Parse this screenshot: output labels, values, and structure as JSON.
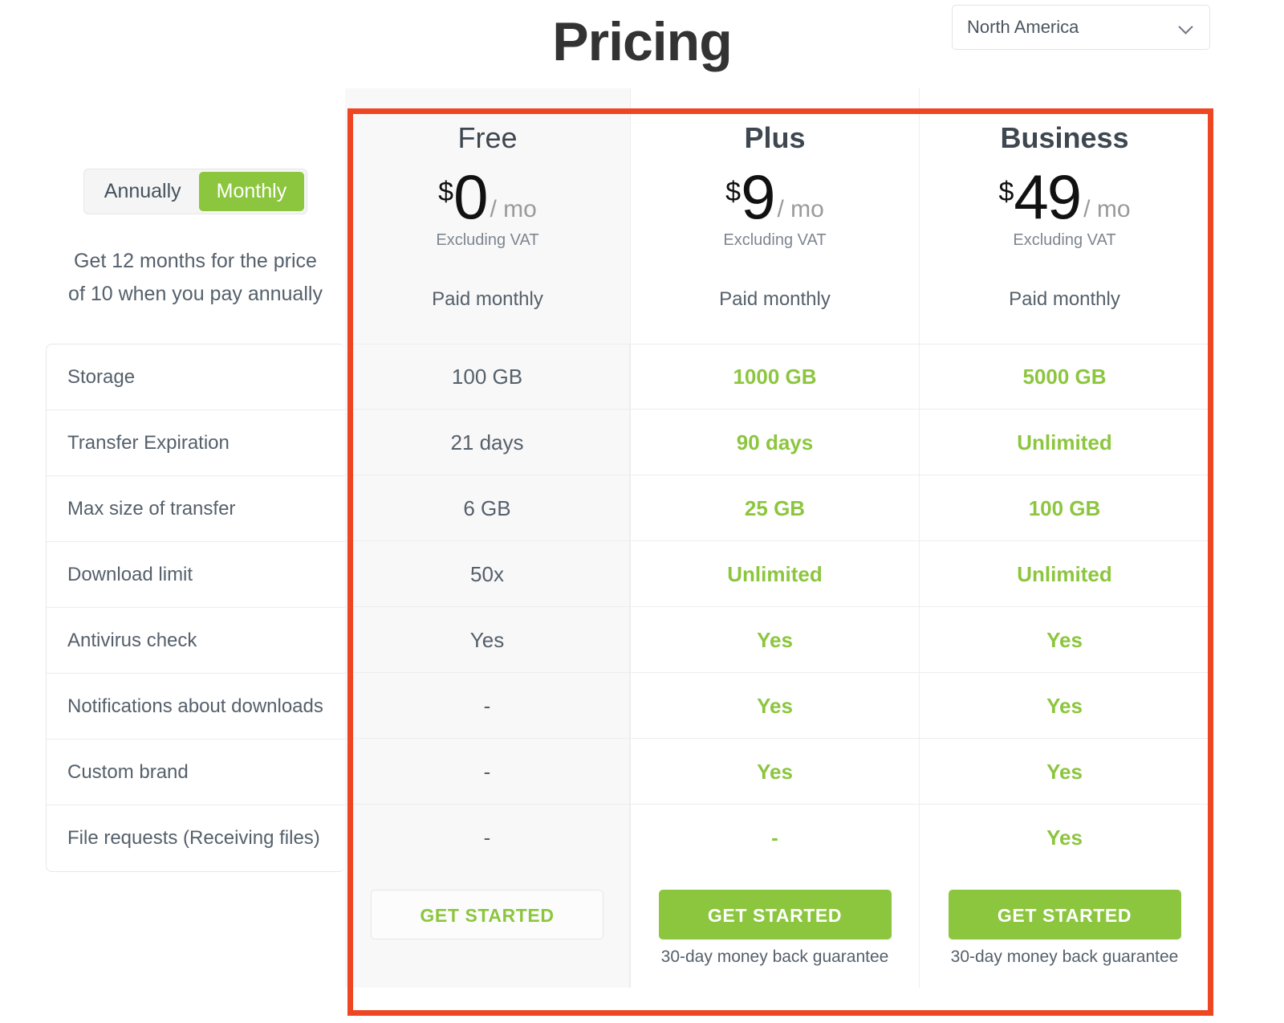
{
  "header": {
    "title": "Pricing",
    "region_selector": {
      "value": "North America",
      "icon": "chevron-down-icon"
    }
  },
  "billing": {
    "options": [
      {
        "label": "Annually",
        "active": false
      },
      {
        "label": "Monthly",
        "active": true
      }
    ],
    "note": "Get 12 months for the price of 10 when you pay annually"
  },
  "plans": [
    {
      "name": "Free",
      "currency": "$",
      "amount": "0",
      "period": "/ mo",
      "vat_note": "Excluding VAT",
      "billing_note": "Paid monthly",
      "cta": "GET STARTED",
      "cta_style": "ghost",
      "guarantee": "",
      "highlighted": false
    },
    {
      "name": "Plus",
      "currency": "$",
      "amount": "9",
      "period": "/ mo",
      "vat_note": "Excluding VAT",
      "billing_note": "Paid monthly",
      "cta": "GET STARTED",
      "cta_style": "solid",
      "guarantee": "30-day money back guarantee",
      "highlighted": false
    },
    {
      "name": "Business",
      "currency": "$",
      "amount": "49",
      "period": "/ mo",
      "vat_note": "Excluding VAT",
      "billing_note": "Paid monthly",
      "cta": "GET STARTED",
      "cta_style": "solid",
      "guarantee": "30-day money back guarantee",
      "highlighted": false
    }
  ],
  "features": [
    {
      "label": "Storage",
      "free": "100 GB",
      "plus": "1000 GB",
      "business": "5000 GB"
    },
    {
      "label": "Transfer Expiration",
      "free": "21 days",
      "plus": "90 days",
      "business": "Unlimited"
    },
    {
      "label": "Max size of transfer",
      "free": "6 GB",
      "plus": "25 GB",
      "business": "100 GB"
    },
    {
      "label": "Download limit",
      "free": "50x",
      "plus": "Unlimited",
      "business": "Unlimited"
    },
    {
      "label": "Antivirus check",
      "free": "Yes",
      "plus": "Yes",
      "business": "Yes"
    },
    {
      "label": "Notifications about downloads",
      "free": "-",
      "plus": "Yes",
      "business": "Yes"
    },
    {
      "label": "Custom brand",
      "free": "-",
      "plus": "Yes",
      "business": "Yes"
    },
    {
      "label": "File requests (Receiving files)",
      "free": "-",
      "plus": "-",
      "business": "Yes"
    }
  ],
  "colors": {
    "accent_green": "#8CC63E",
    "highlight_red": "#EE4622",
    "text": "#55606b",
    "shaded_bg": "#f8f8f8"
  }
}
